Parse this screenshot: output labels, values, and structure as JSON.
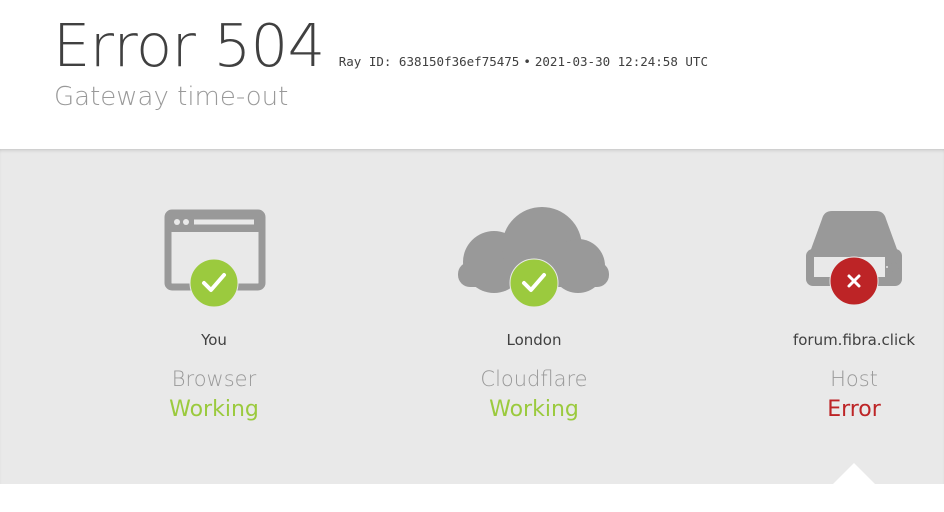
{
  "header": {
    "error_title": "Error 504",
    "ray_id": "Ray ID: 638150f36ef75475",
    "separator": "•",
    "timestamp": "2021-03-30 12:24:58 UTC",
    "subtitle": "Gateway time-out"
  },
  "nodes": [
    {
      "location": "You",
      "label": "Browser",
      "status": "Working",
      "icon": "browser-icon",
      "badge_icon": "check-icon",
      "state": "ok"
    },
    {
      "location": "London",
      "label": "Cloudflare",
      "status": "Working",
      "icon": "cloud-icon",
      "badge_icon": "check-icon",
      "state": "ok"
    },
    {
      "location": "forum.fibra.click",
      "label": "Host",
      "status": "Error",
      "icon": "server-icon",
      "badge_icon": "error-x-icon",
      "state": "error"
    }
  ],
  "colors": {
    "ok": "#9bca3e",
    "error": "#bd2426",
    "icon_gray": "#999999",
    "panel_bg": "#e9e9e9"
  }
}
